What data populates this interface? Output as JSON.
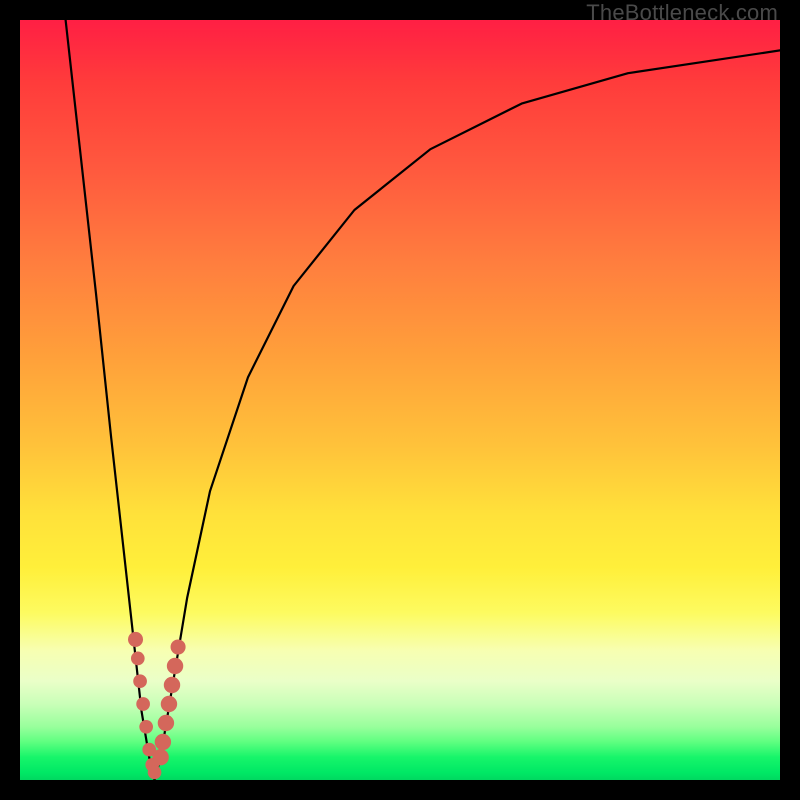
{
  "watermark": "TheBottleneck.com",
  "chart_data": {
    "type": "line",
    "title": "",
    "xlabel": "",
    "ylabel": "",
    "xlim": [
      0,
      100
    ],
    "ylim": [
      0,
      100
    ],
    "series": [
      {
        "name": "bottleneck-curve",
        "x": [
          6,
          8,
          10,
          12,
          14,
          15,
          16,
          17,
          17.7,
          18.5,
          20,
          22,
          25,
          30,
          36,
          44,
          54,
          66,
          80,
          100
        ],
        "y": [
          100,
          82,
          64,
          45,
          27,
          18,
          9,
          3,
          0,
          3,
          12,
          24,
          38,
          53,
          65,
          75,
          83,
          89,
          93,
          96
        ]
      }
    ],
    "markers": {
      "name": "highlight-cluster",
      "points": [
        {
          "x": 15.2,
          "y": 18.5,
          "r": 1.1
        },
        {
          "x": 15.5,
          "y": 16,
          "r": 1.0
        },
        {
          "x": 15.8,
          "y": 13,
          "r": 1.0
        },
        {
          "x": 16.2,
          "y": 10,
          "r": 1.0
        },
        {
          "x": 16.6,
          "y": 7,
          "r": 1.0
        },
        {
          "x": 17.0,
          "y": 4,
          "r": 1.0
        },
        {
          "x": 17.4,
          "y": 2,
          "r": 1.0
        },
        {
          "x": 17.7,
          "y": 1,
          "r": 1.0
        },
        {
          "x": 18.5,
          "y": 3,
          "r": 1.2
        },
        {
          "x": 18.8,
          "y": 5,
          "r": 1.2
        },
        {
          "x": 19.2,
          "y": 7.5,
          "r": 1.2
        },
        {
          "x": 19.6,
          "y": 10,
          "r": 1.2
        },
        {
          "x": 20.0,
          "y": 12.5,
          "r": 1.2
        },
        {
          "x": 20.4,
          "y": 15,
          "r": 1.2
        },
        {
          "x": 20.8,
          "y": 17.5,
          "r": 1.1
        }
      ]
    },
    "background_gradient": {
      "top": "#ff1f44",
      "mid": "#ffe13a",
      "bottom": "#00d860"
    }
  }
}
